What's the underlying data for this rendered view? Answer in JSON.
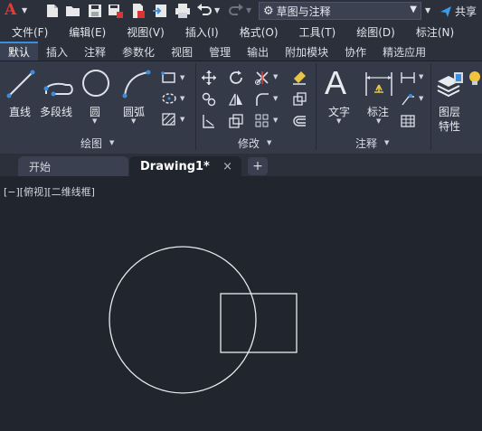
{
  "app": {
    "logo_letter": "A",
    "workspace": "草图与注释",
    "share_label": "共享"
  },
  "menus": [
    "文件(F)",
    "编辑(E)",
    "视图(V)",
    "插入(I)",
    "格式(O)",
    "工具(T)",
    "绘图(D)",
    "标注(N)"
  ],
  "ribbon_tabs": [
    "默认",
    "插入",
    "注释",
    "参数化",
    "视图",
    "管理",
    "输出",
    "附加模块",
    "协作",
    "精选应用"
  ],
  "ribbon": {
    "draw": {
      "panel_label": "绘图",
      "line": "直线",
      "polyline": "多段线",
      "circle": "圆",
      "arc": "圆弧"
    },
    "modify": {
      "panel_label": "修改"
    },
    "annotation": {
      "panel_label": "注释",
      "text": "文字",
      "dimension": "标注"
    },
    "layers": {
      "label_line1": "图层",
      "label_line2": "特性"
    }
  },
  "doc_tabs": {
    "start": "开始",
    "drawing": "Drawing1*",
    "close_glyph": "×",
    "add_glyph": "+"
  },
  "viewport_label": "[−][俯视][二维线框]",
  "colors": {
    "accent": "#3c8dde",
    "canvas_bg": "#21252e",
    "ribbon_bg": "#343a48",
    "logo_red": "#e23b3b"
  }
}
